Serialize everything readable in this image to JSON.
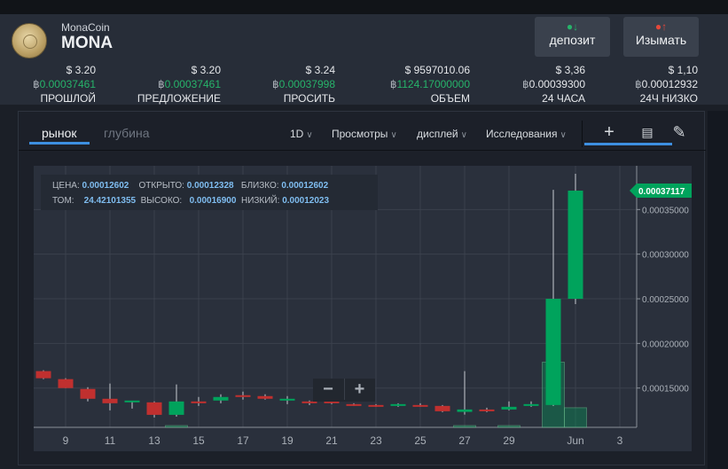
{
  "coin": {
    "name": "MonaCoin",
    "symbol": "MONA"
  },
  "buttons": {
    "deposit": "депозит",
    "withdraw": "Изымать",
    "deposit_icon": "coin-arrow-down-icon",
    "withdraw_icon": "coin-arrow-up-icon"
  },
  "stats": [
    {
      "usd": "$ 3.20",
      "btc": "0.00037461",
      "label": "ПРОШЛОЙ",
      "green": true
    },
    {
      "usd": "$ 3.20",
      "btc": "0.00037461",
      "label": "ПРЕДЛОЖЕНИЕ",
      "green": true
    },
    {
      "usd": "$ 3.24",
      "btc": "0.00037998",
      "label": "ПРОСИТЬ",
      "green": true
    },
    {
      "usd": "$ 9597010.06",
      "btc": "1124.17000000",
      "label": "ОБЪЕМ",
      "green": true
    },
    {
      "usd": "$ 3,36",
      "btc": "0.00039300",
      "label": "24 ЧАСА",
      "green": false
    },
    {
      "usd": "$ 1,10",
      "btc": "0.00012932",
      "label": "24Ч НИЗКО",
      "green": false
    }
  ],
  "tabs": {
    "market": "рынок",
    "depth": "глубина"
  },
  "toolbar": {
    "interval": "1D",
    "views": "Просмотры",
    "display": "дисплей",
    "studies": "Исследования",
    "tools": [
      "crosshair-icon",
      "comment-icon",
      "pencil-icon"
    ]
  },
  "hover": {
    "price_l": "ЦЕНА:",
    "price": "0.00012602",
    "open_l": "ОТКРЫТО:",
    "open": "0.00012328",
    "close_l": "БЛИЗКО:",
    "close": "0.00012602",
    "vol_l": "ТОМ:",
    "vol": "24.42101355",
    "high_l": "ВЫСОКО:",
    "high": "0.00016900",
    "low_l": "НИЗКИЙ:",
    "low": "0.00012023"
  },
  "zoom": {
    "out": "−",
    "in": "+"
  },
  "colors": {
    "up": "#00a35c",
    "down": "#c0302f",
    "accent": "#3d8fe0",
    "btc_green": "#27b36a"
  },
  "chart_data": {
    "type": "candlestick",
    "last_price_label": "0.00037117",
    "yticks": [
      "0.00015000",
      "0.00020000",
      "0.00025000",
      "0.00030000",
      "0.00035000"
    ],
    "ytick_values": [
      0.00015,
      0.0002,
      0.00025,
      0.0003,
      0.00035
    ],
    "ylim": [
      0.000106,
      0.000399
    ],
    "xticks": [
      {
        "day": 9,
        "label": "9"
      },
      {
        "day": 11,
        "label": "11"
      },
      {
        "day": 13,
        "label": "13"
      },
      {
        "day": 15,
        "label": "15"
      },
      {
        "day": 17,
        "label": "17"
      },
      {
        "day": 19,
        "label": "19"
      },
      {
        "day": 21,
        "label": "21"
      },
      {
        "day": 23,
        "label": "23"
      },
      {
        "day": 25,
        "label": "25"
      },
      {
        "day": 27,
        "label": "27"
      },
      {
        "day": 29,
        "label": "29"
      },
      {
        "day": 32,
        "label": "Jun"
      },
      {
        "day": 34,
        "label": "3"
      }
    ],
    "candles": [
      {
        "day": 8,
        "o": 0.000169,
        "h": 0.00017,
        "l": 0.00016,
        "c": 0.000161
      },
      {
        "day": 9,
        "o": 0.00016,
        "h": 0.000161,
        "l": 0.00015,
        "c": 0.00015
      },
      {
        "day": 10,
        "o": 0.000149,
        "h": 0.000151,
        "l": 0.000135,
        "c": 0.000138
      },
      {
        "day": 11,
        "o": 0.000138,
        "h": 0.000155,
        "l": 0.000125,
        "c": 0.000133
      },
      {
        "day": 12,
        "o": 0.000134,
        "h": 0.000135,
        "l": 0.000127,
        "c": 0.000136
      },
      {
        "day": 13,
        "o": 0.000134,
        "h": 0.000135,
        "l": 0.000117,
        "c": 0.00012
      },
      {
        "day": 14,
        "o": 0.00012,
        "h": 0.000154,
        "l": 0.000118,
        "c": 0.000135
      },
      {
        "day": 15,
        "o": 0.000135,
        "h": 0.00014,
        "l": 0.00013,
        "c": 0.000133
      },
      {
        "day": 16,
        "o": 0.000136,
        "h": 0.000143,
        "l": 0.000133,
        "c": 0.00014
      },
      {
        "day": 17,
        "o": 0.000142,
        "h": 0.000146,
        "l": 0.000137,
        "c": 0.00014
      },
      {
        "day": 18,
        "o": 0.000141,
        "h": 0.000143,
        "l": 0.000137,
        "c": 0.000138
      },
      {
        "day": 19,
        "o": 0.000136,
        "h": 0.000141,
        "l": 0.000132,
        "c": 0.000138
      },
      {
        "day": 20,
        "o": 0.000135,
        "h": 0.000136,
        "l": 0.000131,
        "c": 0.000133
      },
      {
        "day": 21,
        "o": 0.000135,
        "h": 0.000136,
        "l": 0.000132,
        "c": 0.000133
      },
      {
        "day": 22,
        "o": 0.000132,
        "h": 0.000133,
        "l": 0.00013,
        "c": 0.00013
      },
      {
        "day": 23,
        "o": 0.000131,
        "h": 0.000132,
        "l": 0.000129,
        "c": 0.00013
      },
      {
        "day": 24,
        "o": 0.00013,
        "h": 0.000133,
        "l": 0.000129,
        "c": 0.000132
      },
      {
        "day": 25,
        "o": 0.000131,
        "h": 0.000133,
        "l": 0.000129,
        "c": 0.00013
      },
      {
        "day": 26,
        "o": 0.00013,
        "h": 0.000131,
        "l": 0.000123,
        "c": 0.000124
      },
      {
        "day": 27,
        "o": 0.00012328,
        "h": 0.000169,
        "l": 0.00012023,
        "c": 0.00012602
      },
      {
        "day": 28,
        "o": 0.000126,
        "h": 0.000128,
        "l": 0.000123,
        "c": 0.000124
      },
      {
        "day": 29,
        "o": 0.000126,
        "h": 0.000135,
        "l": 0.000125,
        "c": 0.000129
      },
      {
        "day": 30,
        "o": 0.00013,
        "h": 0.000135,
        "l": 0.000129,
        "c": 0.000132
      },
      {
        "day": 31,
        "o": 0.000131,
        "h": 0.000372,
        "l": 0.00013,
        "c": 0.00025
      },
      {
        "day": 32,
        "o": 0.00025,
        "h": 0.00039,
        "l": 0.000244,
        "c": 0.00037117
      }
    ],
    "volume": [
      {
        "day": 31,
        "value": 7.3e-05,
        "up": true
      },
      {
        "day": 32,
        "value": 2.2e-05,
        "up": true
      },
      {
        "day": 27,
        "value": 2e-06,
        "up": true
      },
      {
        "day": 29,
        "value": 2e-06,
        "up": true
      },
      {
        "day": 14,
        "value": 2e-06,
        "up": true
      }
    ]
  }
}
